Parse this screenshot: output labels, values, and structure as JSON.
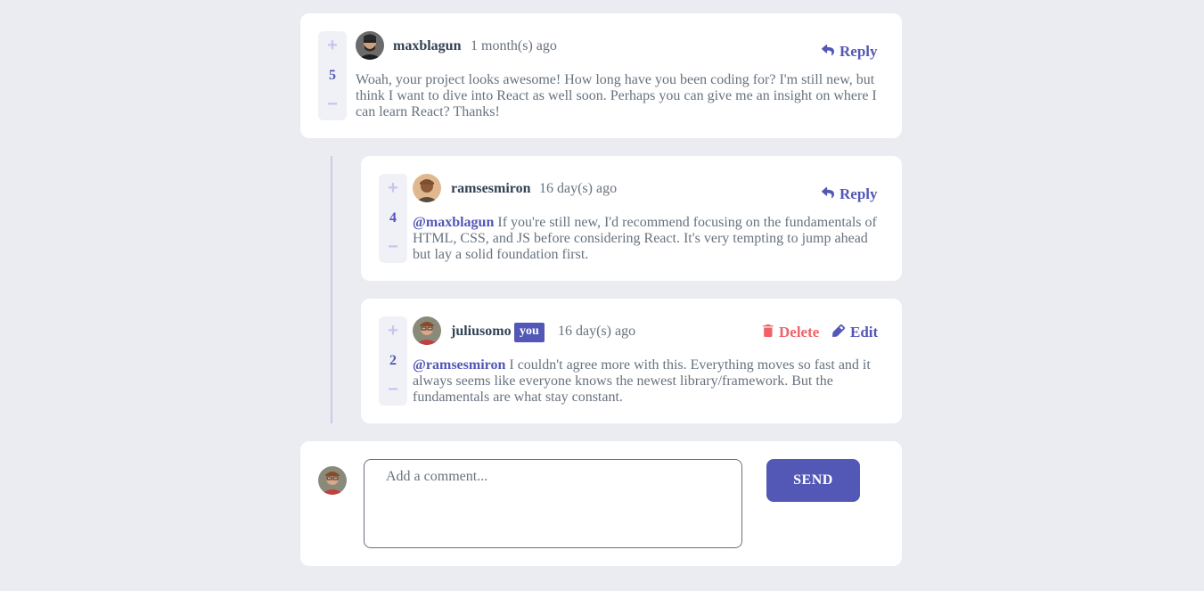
{
  "comments": [
    {
      "username": "maxblagun",
      "timestamp": "1 month(s) ago",
      "score": "5",
      "body": "Woah, your project looks awesome! How long have you been coding for? I'm still new, but think I want to dive into React as well soon. Perhaps you can give me an insight on where I can learn React? Thanks!",
      "reply_label": "Reply"
    }
  ],
  "replies": [
    {
      "username": "ramsesmiron",
      "timestamp": "16 day(s) ago",
      "score": "4",
      "mention": "@maxblagun",
      "body": " If you're still new, I'd recommend focusing on the fundamentals of HTML, CSS, and JS before considering React. It's very tempting to jump ahead but lay a solid foundation first.",
      "reply_label": "Reply"
    },
    {
      "username": "juliusomo",
      "you_badge": "you",
      "timestamp": "16 day(s) ago",
      "score": "2",
      "mention": "@ramsesmiron",
      "body": " I couldn't agree more with this. Everything moves so fast and it always seems like everyone knows the newest library/framework. But the fundamentals are what stay constant.",
      "delete_label": "Delete",
      "edit_label": "Edit"
    }
  ],
  "vote": {
    "plus": "+",
    "minus": "−"
  },
  "composer": {
    "placeholder": "Add a comment...",
    "send_label": "SEND"
  },
  "colors": {
    "background": "#eaecf1",
    "card": "#ffffff",
    "accent": "#5357b6",
    "danger": "#ed6368",
    "text": "#67727e",
    "heading": "#334253"
  },
  "icons": {
    "reply": "reply-arrow-icon",
    "delete": "trash-icon",
    "edit": "pencil-icon"
  }
}
